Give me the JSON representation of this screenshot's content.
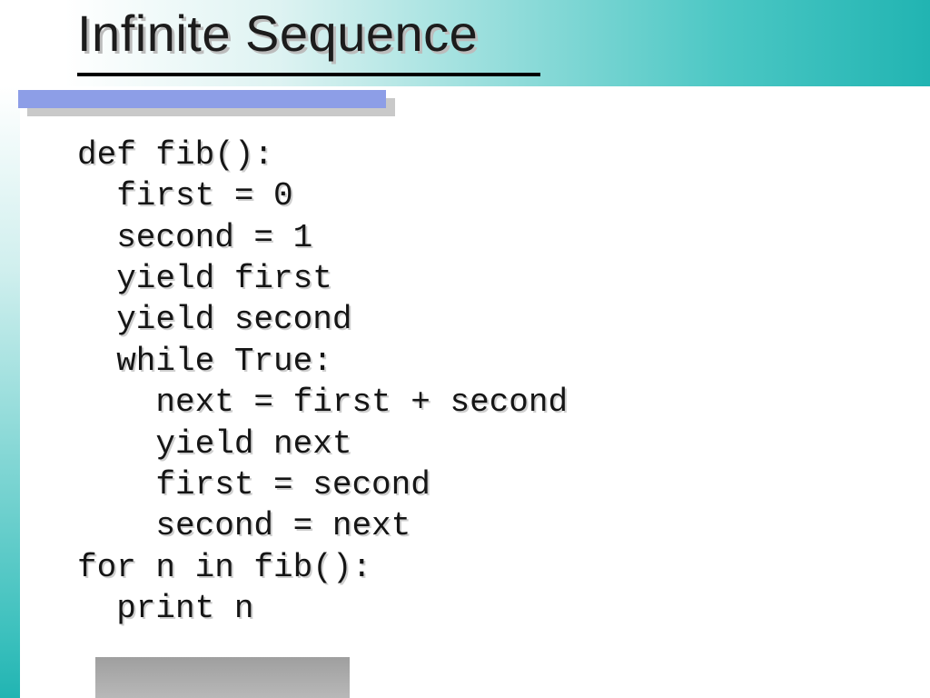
{
  "title": "Infinite Sequence",
  "code": {
    "lines": [
      "def fib():",
      "  first = 0",
      "  second = 1",
      "  yield first",
      "  yield second",
      "  while True:",
      "    next = first + second",
      "    yield next",
      "    first = second",
      "    second = next",
      "for n in fib():",
      "  print n"
    ]
  },
  "accent_colors": {
    "teal": "#21b4b2",
    "blue_bar": "#8d9ee7"
  }
}
